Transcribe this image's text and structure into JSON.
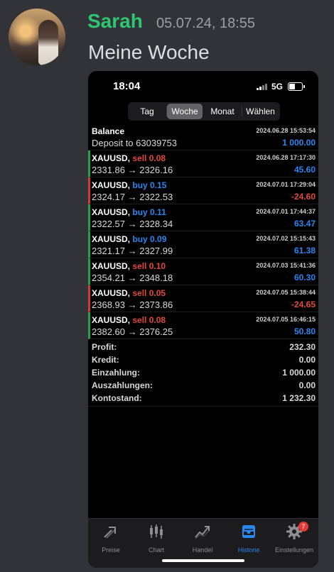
{
  "chat": {
    "username": "Sarah",
    "timestamp": "05.07.24, 18:55",
    "message": "Meine Woche"
  },
  "phone": {
    "status_time": "18:04",
    "network": "5G",
    "segments": [
      "Tag",
      "Woche",
      "Monat",
      "Wählen"
    ],
    "active_segment": "Woche",
    "balance_row": {
      "title": "Balance",
      "subtitle": "Deposit to 63039753",
      "date": "2024.06.28 15:53:54",
      "value": "1 000.00"
    },
    "trades": [
      {
        "symbol": "XAUUSD,",
        "side": "sell",
        "volume": "0.08",
        "prices": "2331.86 → 2326.16",
        "date": "2024.06.28 17:17:30",
        "value": "45.60",
        "result": "profit"
      },
      {
        "symbol": "XAUUSD,",
        "side": "buy",
        "volume": "0.15",
        "prices": "2324.17 → 2322.53",
        "date": "2024.07.01 17:29:04",
        "value": "-24.60",
        "result": "loss"
      },
      {
        "symbol": "XAUUSD,",
        "side": "buy",
        "volume": "0.11",
        "prices": "2322.57 → 2328.34",
        "date": "2024.07.01 17:44:37",
        "value": "63.47",
        "result": "profit"
      },
      {
        "symbol": "XAUUSD,",
        "side": "buy",
        "volume": "0.09",
        "prices": "2321.17 → 2327.99",
        "date": "2024.07.02 15:15:43",
        "value": "61.38",
        "result": "profit"
      },
      {
        "symbol": "XAUUSD,",
        "side": "sell",
        "volume": "0.10",
        "prices": "2354.21 → 2348.18",
        "date": "2024.07.03 15:41:36",
        "value": "60.30",
        "result": "profit"
      },
      {
        "symbol": "XAUUSD,",
        "side": "sell",
        "volume": "0.05",
        "prices": "2368.93 → 2373.86",
        "date": "2024.07.05 15:38:44",
        "value": "-24.65",
        "result": "loss"
      },
      {
        "symbol": "XAUUSD,",
        "side": "sell",
        "volume": "0.08",
        "prices": "2382.60 → 2376.25",
        "date": "2024.07.05 16:46:15",
        "value": "50.80",
        "result": "profit"
      }
    ],
    "summary": [
      {
        "label": "Profit:",
        "value": "232.30"
      },
      {
        "label": "Kredit:",
        "value": "0.00"
      },
      {
        "label": "Einzahlung:",
        "value": "1 000.00"
      },
      {
        "label": "Auszahlungen:",
        "value": "0.00"
      },
      {
        "label": "Kontostand:",
        "value": "1 232.30"
      }
    ],
    "tabs": [
      {
        "label": "Preise",
        "icon": "prices-icon"
      },
      {
        "label": "Chart",
        "icon": "candlestick-chart-icon"
      },
      {
        "label": "Handel",
        "icon": "trade-chart-icon"
      },
      {
        "label": "Historie",
        "icon": "history-inbox-icon"
      },
      {
        "label": "Einstellungen",
        "icon": "gear-icon",
        "badge": "7"
      }
    ],
    "active_tab": "Historie",
    "colors": {
      "profit_accent": "#1da44a",
      "loss_accent": "#d43a2f",
      "positive_value": "#2a86f0",
      "negative_value": "#e1493d",
      "username": "#2dc770"
    }
  }
}
